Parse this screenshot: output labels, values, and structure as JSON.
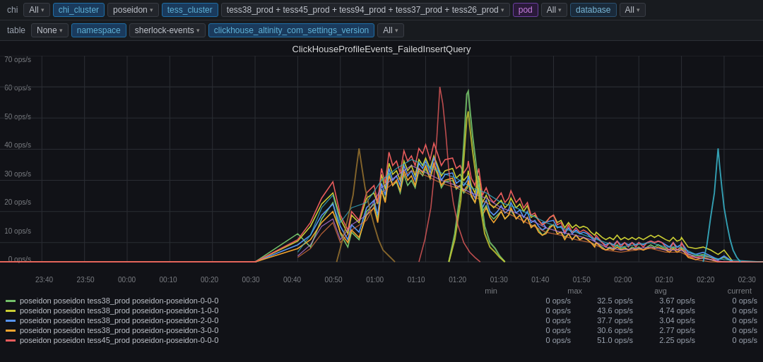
{
  "toolbar_row1": {
    "chi_label": "chi",
    "chi_all": "All",
    "chi_cluster_label": "chi_cluster",
    "poseidon_label": "poseidon",
    "tess_cluster_label": "tess_cluster",
    "tess_servers": "tess38_prod + tess45_prod + tess94_prod + tess37_prod + tess26_prod",
    "pod_label": "pod",
    "pod_all": "All",
    "database_label": "database",
    "database_all": "All"
  },
  "toolbar_row2": {
    "table_label": "table",
    "table_none": "None",
    "namespace_label": "namespace",
    "namespace_val": "sherlock-events",
    "version_label": "clickhouse_altinity_com_settings_version",
    "version_all": "All"
  },
  "chart": {
    "title": "ClickHouseProfileEvents_FailedInsertQuery",
    "y_labels": [
      "70 ops/s",
      "60 ops/s",
      "50 ops/s",
      "40 ops/s",
      "30 ops/s",
      "20 ops/s",
      "10 ops/s",
      "0 ops/s"
    ],
    "x_labels": [
      "23:40",
      "23:50",
      "00:00",
      "00:10",
      "00:20",
      "00:30",
      "00:40",
      "00:50",
      "01:00",
      "01:10",
      "01:20",
      "01:30",
      "01:40",
      "01:50",
      "02:00",
      "02:10",
      "02:20",
      "02:30"
    ]
  },
  "legend": {
    "header": {
      "min": "min",
      "max": "max",
      "avg": "avg",
      "current": "current"
    },
    "rows": [
      {
        "color": "#73bf69",
        "label": "poseidon poseidon tess38_prod poseidon-poseidon-0-0-0",
        "min": "0 ops/s",
        "max": "32.5 ops/s",
        "avg": "3.67 ops/s",
        "current": "0 ops/s"
      },
      {
        "color": "#cacd33",
        "label": "poseidon poseidon tess38_prod poseidon-poseidon-1-0-0",
        "min": "0 ops/s",
        "max": "43.6 ops/s",
        "avg": "4.74 ops/s",
        "current": "0 ops/s"
      },
      {
        "color": "#5794f2",
        "label": "poseidon poseidon tess38_prod poseidon-poseidon-2-0-0",
        "min": "0 ops/s",
        "max": "37.7 ops/s",
        "avg": "3.04 ops/s",
        "current": "0 ops/s"
      },
      {
        "color": "#f2a42e",
        "label": "poseidon poseidon tess38_prod poseidon-poseidon-3-0-0",
        "min": "0 ops/s",
        "max": "30.6 ops/s",
        "avg": "2.77 ops/s",
        "current": "0 ops/s"
      },
      {
        "color": "#e85c5c",
        "label": "poseidon poseidon tess45_prod poseidon-poseidon-0-0-0",
        "min": "0 ops/s",
        "max": "51.0 ops/s",
        "avg": "2.25 ops/s",
        "current": "0 ops/s"
      }
    ]
  }
}
